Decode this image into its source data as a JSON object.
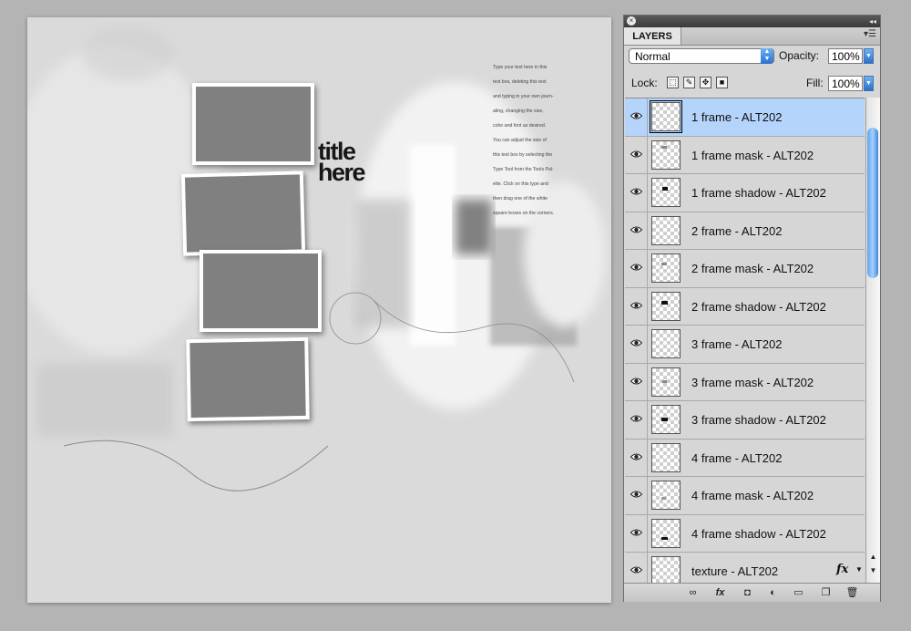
{
  "canvas": {
    "title_lines": [
      "title",
      "here"
    ],
    "journal_lines": [
      "Type your text here in this",
      "text box, deleting this text",
      "and typing in your own journ-",
      "aling, changing the size,",
      "color and font as desired.",
      "You can adjust the size of",
      "this text box by selecting the",
      "Type Tool from the Tools Pal-",
      "ette.  Click on this type and",
      "then drag one of the white",
      "square boxes on the corners."
    ]
  },
  "panel": {
    "tab_label": "LAYERS",
    "blend_mode": "Normal",
    "opacity_label": "Opacity:",
    "opacity_value": "100%",
    "lock_label": "Lock:",
    "fill_label": "Fill:",
    "fill_value": "100%",
    "layers": [
      {
        "name": "1 frame - ALT202",
        "selected": true
      },
      {
        "name": "1 frame mask - ALT202"
      },
      {
        "name": "1 frame shadow - ALT202"
      },
      {
        "name": "2 frame  - ALT202"
      },
      {
        "name": "2 frame mask - ALT202"
      },
      {
        "name": "2 frame shadow - ALT202"
      },
      {
        "name": "3 frame - ALT202"
      },
      {
        "name": "3 frame mask - ALT202"
      },
      {
        "name": "3 frame shadow - ALT202"
      },
      {
        "name": "4 frame - ALT202"
      },
      {
        "name": "4 frame mask - ALT202"
      },
      {
        "name": "4 frame shadow - ALT202"
      },
      {
        "name": "texture - ALT202",
        "fx": "fx"
      }
    ],
    "icons": {
      "eye": "eye-icon",
      "lock_transparent": "lock-transparent-icon",
      "lock_image": "lock-image-icon",
      "lock_position": "lock-position-icon",
      "lock_all": "lock-all-icon",
      "link": "link-layers-icon",
      "fx": "add-style-icon",
      "mask": "add-mask-icon",
      "adjustment": "adjustment-layer-icon",
      "group": "new-group-icon",
      "new_layer": "new-layer-icon",
      "trash": "delete-layer-icon"
    },
    "accent_selected": "#b5d4fb",
    "accent_scroll": "#5ea4ee"
  }
}
